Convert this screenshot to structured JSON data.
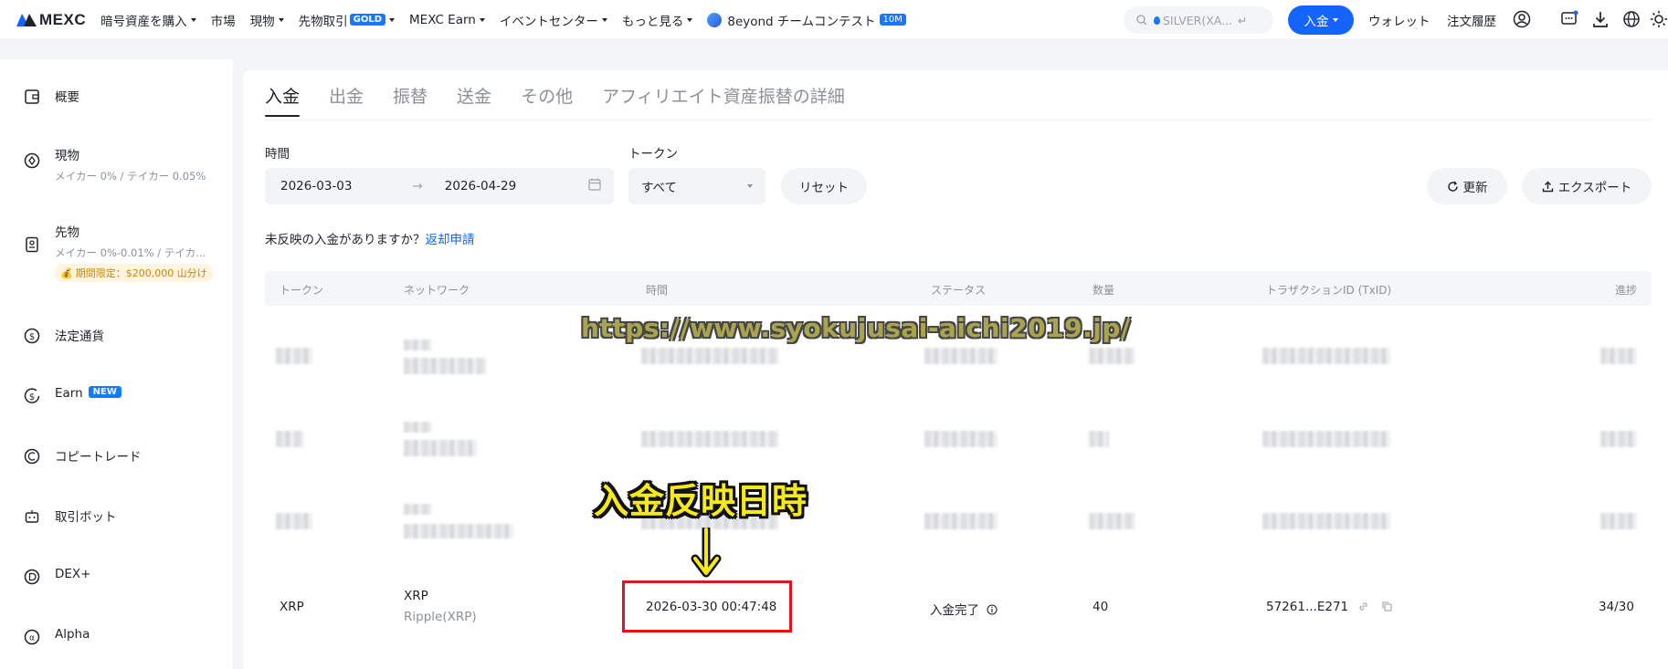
{
  "brand": {
    "name": "MEXC",
    "accent": "#1664ff"
  },
  "nav": {
    "items": [
      {
        "label": "暗号資産を購入",
        "caret": true
      },
      {
        "label": "市場",
        "caret": false
      },
      {
        "label": "現物",
        "caret": true
      },
      {
        "label": "先物取引",
        "badge": "GOLD",
        "caret": true
      },
      {
        "label": "MEXC Earn",
        "caret": true
      },
      {
        "label": "イベントセンター",
        "caret": true
      },
      {
        "label": "もっと見る",
        "caret": true
      }
    ],
    "contest": {
      "label": "8eyond チームコンテスト",
      "badge": "10M"
    },
    "search_text": "SILVER(XA...",
    "deposit_button": "入金",
    "wallet_link": "ウォレット",
    "orders_link": "注文履歴"
  },
  "sidebar": {
    "overview": "概要",
    "spot": {
      "label": "現物",
      "sub": "メイカー 0% / テイカー 0.05%"
    },
    "futures": {
      "label": "先物",
      "sub": "メイカー 0%-0.01% / テイカ...",
      "promo": "期間限定：$200,000 山分け"
    },
    "fiat": "法定通貨",
    "earn": {
      "label": "Earn",
      "badge": "NEW"
    },
    "copytrade": "コピートレード",
    "bot": "取引ボット",
    "dex": "DEX+",
    "alpha": "Alpha"
  },
  "tabs": [
    "入金",
    "出金",
    "振替",
    "送金",
    "その他",
    "アフィリエイト資産振替の詳細"
  ],
  "filters": {
    "time_label": "時間",
    "date_start": "2026-03-03",
    "date_end": "2026-04-29",
    "token_label": "トークン",
    "token_value": "すべて",
    "reset": "リセット",
    "refresh": "更新",
    "export": "エクスポート"
  },
  "notice": {
    "text": "未反映の入金がありますか？",
    "link": "返却申請"
  },
  "table": {
    "headers": [
      "トークン",
      "ネットワーク",
      "時間",
      "ステータス",
      "数量",
      "トラザクションID (TxID)",
      "進捗"
    ],
    "row": {
      "token": "XRP",
      "network": "XRP",
      "network_sub": "Ripple(XRP)",
      "time": "2026-03-30 00:47:48",
      "status": "入金完了",
      "amount": "40",
      "txid": "57261...E271",
      "progress": "34/30"
    }
  },
  "overlay": {
    "annotation": "入金反映日時",
    "watermark": "https://www.syokujusai-aichi2019.jp/",
    "box_color": "#e0141b"
  }
}
